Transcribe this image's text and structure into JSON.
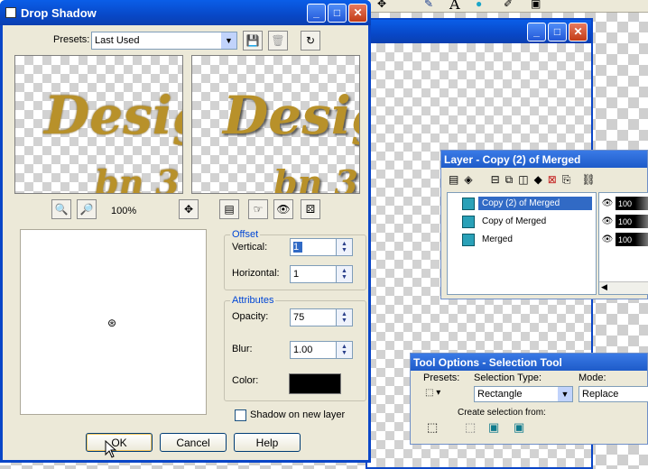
{
  "dialog": {
    "title": "Drop Shadow",
    "presets_label": "Presets:",
    "presets_value": "Last Used",
    "preview_text_1": "Desig",
    "preview_text_2": "bn 3",
    "zoom": "100%",
    "offset_group": "Offset",
    "vertical_label": "Vertical:",
    "vertical_value": "1",
    "horizontal_label": "Horizontal:",
    "horizontal_value": "1",
    "attributes_group": "Attributes",
    "opacity_label": "Opacity:",
    "opacity_value": "75",
    "blur_label": "Blur:",
    "blur_value": "1.00",
    "color_label": "Color:",
    "color_value": "#000000",
    "shadow_checkbox_label": "Shadow on new layer",
    "ok_label": "OK",
    "cancel_label": "Cancel",
    "help_label": "Help"
  },
  "layers": {
    "title": "Layer - Copy (2) of Merged",
    "items": [
      {
        "name": "Copy (2) of Merged",
        "opacity": "100",
        "selected": true
      },
      {
        "name": "Copy of Merged",
        "opacity": "100",
        "selected": false
      },
      {
        "name": "Merged",
        "opacity": "100",
        "selected": false
      }
    ]
  },
  "tool_options": {
    "title": "Tool Options - Selection Tool",
    "presets_label": "Presets:",
    "selection_type_label": "Selection Type:",
    "selection_type_value": "Rectangle",
    "mode_label": "Mode:",
    "mode_value": "Replace",
    "create_from_label": "Create selection from:"
  },
  "top_toolbar": {
    "text_tool_glyph": "A"
  },
  "colors": {
    "xp_blue": "#0a5ee8",
    "dialog_face": "#ece9d8",
    "selected_row": "#316ac5"
  }
}
